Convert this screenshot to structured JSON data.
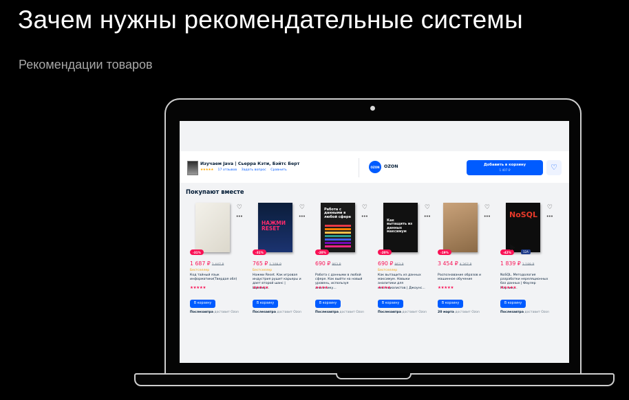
{
  "slide": {
    "title": "Зачем нужны рекомендательные системы",
    "subtitle": "Рекомендации товаров"
  },
  "header": {
    "product_title": "Изучаем Java | Сьерра Кэти, Бэйтс Берт",
    "stars": "★★★★★",
    "reviews": "17 отзывов",
    "ask": "Задать вопрос",
    "compare": "Сравнить",
    "seller_logo": "OZON",
    "seller_name": "OZON",
    "cart_label": "Добавить в корзину",
    "cart_price": "1 407 ₽",
    "fav_icon": "heart-icon"
  },
  "section_title": "Покупают вместе",
  "colors": {
    "accent": "#005bff",
    "discount": "#f91155",
    "bestseller": "#f1a10a"
  },
  "products": [
    {
      "discount": "-31%",
      "price": "1 687 ₽",
      "old_price": "2 447 ₽",
      "bestseller": "Бестселлер",
      "desc": "Код тайный язык информатики(Твердая обл)",
      "stars": "★★★★★",
      "buy": "В корзину",
      "delivery_day": "Послезавтра",
      "delivery_by": "доставит Ozon",
      "cover_text": "",
      "cover_sub": ""
    },
    {
      "discount": "-31%",
      "price": "765 ₽",
      "old_price": "1 109 ₽",
      "bestseller": "Бестселлер",
      "desc": "Нажми Reset. Как игровая индустрия рушит карьеры и дает второй шанс | Шрейер...",
      "stars": "★★★★★",
      "buy": "В корзину",
      "delivery_day": "Послезавтра",
      "delivery_by": "доставит Ozon",
      "cover_text": "НАЖМИ RESET",
      "cover_sub": ""
    },
    {
      "discount": "-20%",
      "price": "690 ₽",
      "old_price": "863 ₽",
      "bestseller": "",
      "desc": "Работа с данными в любой сфере. Как выйти на новый уровень, используя аналитику...",
      "stars": "★★★★",
      "buy": "В корзину",
      "delivery_day": "Послезавтра",
      "delivery_by": "доставит Ozon",
      "cover_text": "Работа с данными в любой сфере",
      "cover_sub": ""
    },
    {
      "discount": "-20%",
      "price": "690 ₽",
      "old_price": "863 ₽",
      "bestseller": "Бестселлер",
      "desc": "Как вытащить из данных максимум. Навыки аналитики для неспециалистов | Джоунс...",
      "stars": "★★★★",
      "buy": "В корзину",
      "delivery_day": "Послезавтра",
      "delivery_by": "доставит Ozon",
      "cover_text": "Как вытащить из данных максимум",
      "cover_sub": ""
    },
    {
      "discount": "-19%",
      "price": "3 454 ₽",
      "old_price": "4 267 ₽",
      "bestseller": "",
      "desc": "Распознавание образов и машинное обучение",
      "stars": "★★★★★",
      "buy": "В корзину",
      "delivery_day": "20 марта",
      "delivery_by": "доставит Ozon",
      "cover_text": "",
      "cover_sub": ""
    },
    {
      "discount": "-42%",
      "price": "1 839 ₽",
      "old_price": "3 189 ₽",
      "bestseller": "",
      "desc": "NoSQL. Методология разработки нереляционных баз данных | Фаулер Мартин,...",
      "stars": "★★★★★",
      "buy": "В корзину",
      "delivery_day": "Послезавтра",
      "delivery_by": "доставит Ozon",
      "cover_text": "NoSQL",
      "cover_sub": "",
      "badge": "12A"
    }
  ]
}
